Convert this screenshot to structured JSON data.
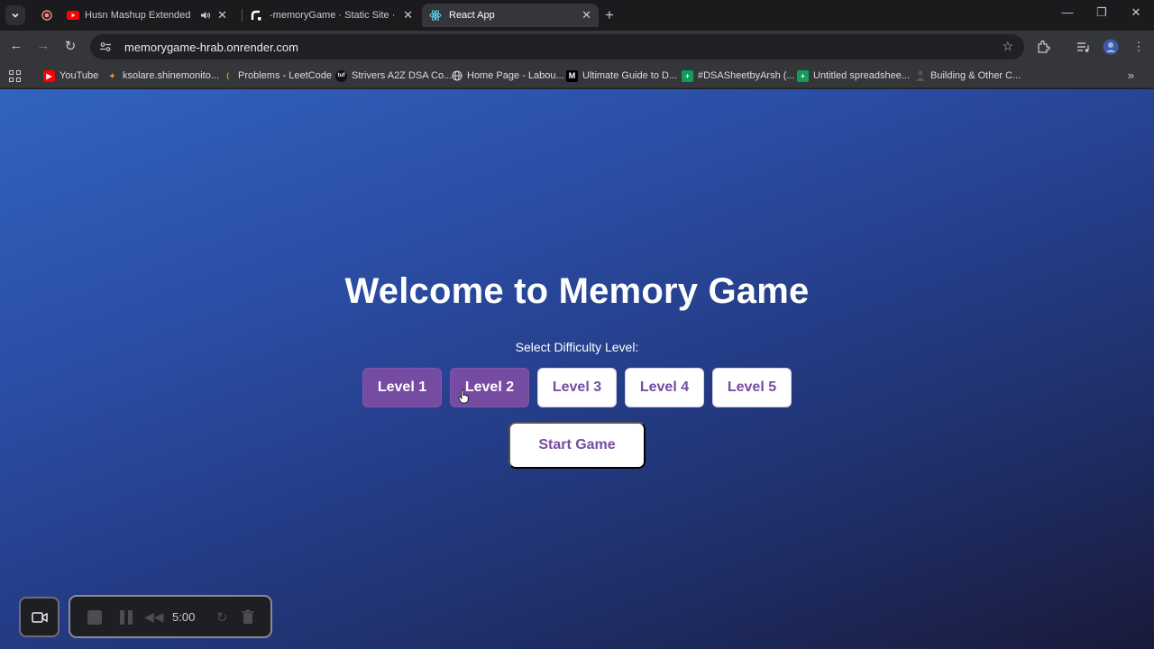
{
  "browser": {
    "tabs": [
      {
        "title": "Husn Mashup Extended | A",
        "active": false
      },
      {
        "title": "-memoryGame · Static Site · R",
        "active": false
      },
      {
        "title": "React App",
        "active": true
      }
    ],
    "url": "memorygame-hrab.onrender.com",
    "bookmarks": [
      {
        "label": "YouTube",
        "icon": "youtube-icon"
      },
      {
        "label": "ksolare.shinemonito...",
        "icon": "spark-icon"
      },
      {
        "label": "Problems - LeetCode",
        "icon": "leetcode-icon"
      },
      {
        "label": "Strivers A2Z DSA Co...",
        "icon": "tuf-icon"
      },
      {
        "label": "Home Page - Labou...",
        "icon": "globe-icon"
      },
      {
        "label": "Ultimate Guide to D...",
        "icon": "medium-icon"
      },
      {
        "label": "#DSASheetbyArsh (...",
        "icon": "sheets-icon"
      },
      {
        "label": "Untitled spreadshee...",
        "icon": "sheets-icon"
      },
      {
        "label": "Building & Other C...",
        "icon": "person-icon"
      }
    ]
  },
  "game": {
    "title": "Welcome to Memory Game",
    "subtitle": "Select Difficulty Level:",
    "levels": [
      {
        "label": "Level 1",
        "selected": true
      },
      {
        "label": "Level 2",
        "selected": true
      },
      {
        "label": "Level 3",
        "selected": false
      },
      {
        "label": "Level 4",
        "selected": false
      },
      {
        "label": "Level 5",
        "selected": false
      }
    ],
    "start_label": "Start Game",
    "accent_color": "#764ba2"
  },
  "recorder": {
    "time": "5:00"
  }
}
